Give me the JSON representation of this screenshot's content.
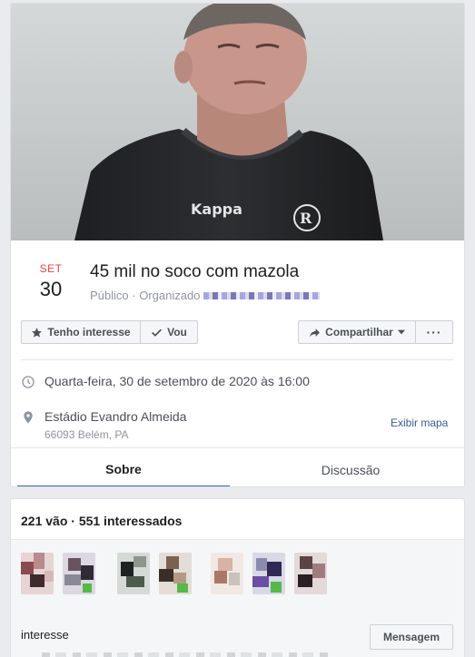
{
  "event": {
    "month": "SET",
    "day": "30",
    "title": "45 mil no soco com mazola",
    "privacy": "Público · Organizado",
    "buttons": {
      "interest": "Tenho interesse",
      "going": "Vou",
      "share": "Compartilhar",
      "more": "···"
    },
    "datetime": "Quarta-feira, 30 de setembro de 2020 às 16:00",
    "venue": "Estádio Evandro Almeida",
    "address": "66093 Belém, PA",
    "map_link": "Exibir mapa",
    "tabs": [
      "Sobre",
      "Discussão"
    ]
  },
  "attendance": {
    "summary": "221 vão · 551 interessados",
    "message_button": "Mensagem",
    "trailing_text": "interesse"
  },
  "colors": {
    "accent": "#4267b2",
    "date_red": "#e9433f",
    "link": "#385898",
    "page_bg": "#e9ebee"
  },
  "icons": {
    "interest": "star-icon",
    "going": "check-icon",
    "share": "share-arrow-icon",
    "time": "clock-icon",
    "location": "map-pin-icon"
  }
}
